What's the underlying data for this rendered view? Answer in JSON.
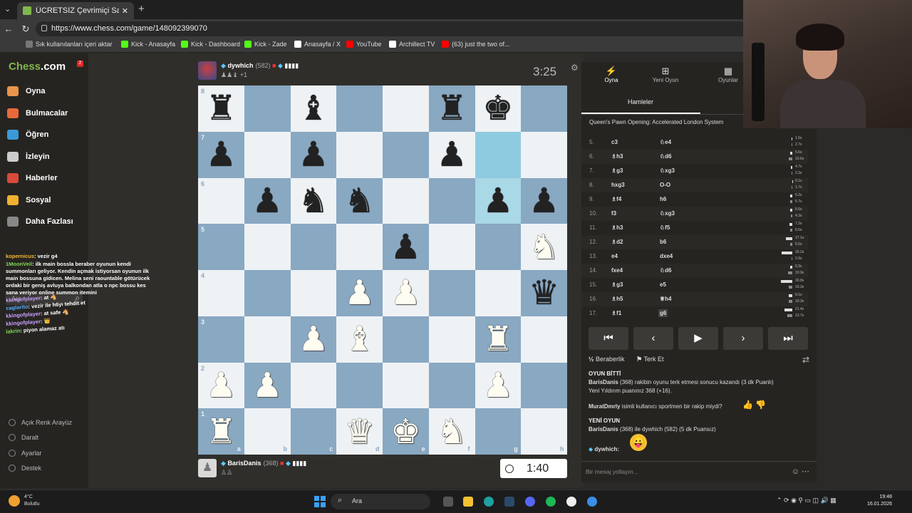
{
  "browser": {
    "tab_title": "ÜCRETSİZ Çevrimiçi Satranç Oyna...",
    "url": "https://www.chess.com/game/148092399070",
    "bookmarks": [
      "Sık kullanılanları içeri aktar",
      "Kick - Anasayfa",
      "Kick - Dashboard",
      "Kick - Zade",
      "Anasayfa / X",
      "YouTube",
      "Archillect TV",
      "(63) just the two of..."
    ],
    "bookmark_colors": [
      "#777777",
      "#53fc18",
      "#53fc18",
      "#53fc18",
      "#ffffff",
      "#ff0000",
      "#ffffff",
      "#ff0000"
    ]
  },
  "sidebar": {
    "logo_a": "Chess",
    "logo_b": ".com",
    "notification_count": "2",
    "items": [
      {
        "label": "Oyna",
        "color": "#e8954a"
      },
      {
        "label": "Bulmacalar",
        "color": "#e86a3a"
      },
      {
        "label": "Öğren",
        "color": "#3a9ad9"
      },
      {
        "label": "İzleyin",
        "color": "#cccccc"
      },
      {
        "label": "Haberler",
        "color": "#d94a3a"
      },
      {
        "label": "Sosyal",
        "color": "#f0b030"
      },
      {
        "label": "Daha Fazlası",
        "color": "#888888"
      }
    ],
    "search_placeholder": "Ara",
    "bottom": [
      "Açık Renk Arayüz",
      "Daralt",
      "Ayarlar",
      "Destek"
    ]
  },
  "chat_overlay": [
    {
      "user": "kopernicus",
      "msg": "vezir g4",
      "color": "#f3b83b"
    },
    {
      "user": "1MoonVeil",
      "msg": "ilk main bossla beraber oyunun kendi summonları geliyor. Kendin açmak istiyorsan oyunun ilk main bossuna gidicen. Melina seni raountable götürücek ordaki bir geniş avluya balkondan atla o npc bossu kes sana veriyor online summon itemini",
      "color": "#7ed957"
    },
    {
      "user": "kkingofplayer",
      "msg": "at 🐴",
      "color": "#c9a0ff"
    },
    {
      "user": "caglarito",
      "msg": "vezir ile h6yı tehdit et",
      "color": "#5ab0ff"
    },
    {
      "user": "kkingofplayer",
      "msg": "at safe 🐴",
      "color": "#c9a0ff"
    },
    {
      "user": "kkingofplayer",
      "msg": "👑",
      "color": "#c9a0ff"
    },
    {
      "user": "lakrin",
      "msg": "piyon alamaz atı",
      "color": "#7ed957"
    }
  ],
  "top_player": {
    "name": "dywhich",
    "rating": "(582)",
    "clock": "3:25",
    "captured": "+1"
  },
  "bottom_player": {
    "name": "BarisDanis",
    "rating": "(368)",
    "clock": "1:40"
  },
  "board": {
    "files": [
      "a",
      "b",
      "c",
      "d",
      "e",
      "f",
      "g",
      "h"
    ],
    "ranks": [
      "8",
      "7",
      "6",
      "5",
      "4",
      "3",
      "2",
      "1"
    ],
    "highlight": [
      "g7",
      "g6"
    ],
    "pieces": [
      {
        "sq": "a8",
        "p": "r"
      },
      {
        "sq": "c8",
        "p": "b"
      },
      {
        "sq": "f8",
        "p": "r"
      },
      {
        "sq": "g8",
        "p": "k"
      },
      {
        "sq": "a7",
        "p": "p"
      },
      {
        "sq": "c7",
        "p": "p"
      },
      {
        "sq": "f7",
        "p": "p"
      },
      {
        "sq": "b6",
        "p": "p"
      },
      {
        "sq": "c6",
        "p": "n"
      },
      {
        "sq": "d6",
        "p": "n"
      },
      {
        "sq": "g6",
        "p": "p"
      },
      {
        "sq": "h6",
        "p": "p"
      },
      {
        "sq": "e5",
        "p": "p"
      },
      {
        "sq": "h5",
        "p": "N"
      },
      {
        "sq": "d4",
        "p": "P"
      },
      {
        "sq": "e4",
        "p": "P"
      },
      {
        "sq": "h4",
        "p": "q"
      },
      {
        "sq": "c3",
        "p": "P"
      },
      {
        "sq": "d3",
        "p": "B"
      },
      {
        "sq": "g3",
        "p": "R"
      },
      {
        "sq": "a2",
        "p": "P"
      },
      {
        "sq": "b2",
        "p": "P"
      },
      {
        "sq": "g2",
        "p": "P"
      },
      {
        "sq": "a1",
        "p": "R"
      },
      {
        "sq": "d1",
        "p": "Q"
      },
      {
        "sq": "e1",
        "p": "K"
      },
      {
        "sq": "f1",
        "p": "N"
      }
    ]
  },
  "panel": {
    "tabs": [
      {
        "icon": "⚡",
        "label": "Oyna"
      },
      {
        "icon": "⊞",
        "label": "Yeni Oyun"
      },
      {
        "icon": "▦",
        "label": "Oyunlar"
      }
    ],
    "subtab": "Hamleler",
    "opening": "Queen's Pawn Opening: Accelerated London System",
    "moves": [
      {
        "n": "5.",
        "w": "c3",
        "b": "♘e4",
        "tw": "1.6s",
        "tb": "2.7s",
        "fw": 0.05,
        "fb": 0.08
      },
      {
        "n": "6.",
        "w": "♗h3",
        "b": "♘d6",
        "tw": "5.6s",
        "tb": "10.6s",
        "fw": 0.16,
        "fb": 0.3
      },
      {
        "n": "7.",
        "w": "♗g3",
        "b": "♘xg3",
        "tw": "4.7s",
        "tb": "2.3s",
        "fw": 0.13,
        "fb": 0.07
      },
      {
        "n": "8.",
        "w": "hxg3",
        "b": "O-O",
        "tw": "0.1s",
        "tb": "1.7s",
        "fw": 0.01,
        "fb": 0.05
      },
      {
        "n": "9.",
        "w": "♗f4",
        "b": "h6",
        "tw": "5.2s",
        "tb": "5.7s",
        "fw": 0.15,
        "fb": 0.16
      },
      {
        "n": "10.",
        "w": "f3",
        "b": "♘xg3",
        "tw": "6.6s",
        "tb": "4.3s",
        "fw": 0.19,
        "fb": 0.12
      },
      {
        "n": "11.",
        "w": "♗h3",
        "b": "♘f5",
        "tw": "7.2s",
        "tb": "6.0s",
        "fw": 0.2,
        "fb": 0.17
      },
      {
        "n": "12.",
        "w": "♗d2",
        "b": "b6",
        "tw": "17.1s",
        "tb": "5.6s",
        "fw": 0.49,
        "fb": 0.16
      },
      {
        "n": "13.",
        "w": "e4",
        "b": "dxe4",
        "tw": "30.2s",
        "tb": "2.9s",
        "fw": 0.86,
        "fb": 0.08
      },
      {
        "n": "14.",
        "w": "fxe4",
        "b": "♘d6",
        "tw": "6.3s",
        "tb": "10.9s",
        "fw": 0.18,
        "fb": 0.31
      },
      {
        "n": "15.",
        "w": "♗g3",
        "b": "e5",
        "tw": "30.8s",
        "tb": "10.3s",
        "fw": 0.88,
        "fb": 0.29
      },
      {
        "n": "16.",
        "w": "♗h5",
        "b": "♕h4",
        "tw": "9.1s",
        "tb": "10.3s",
        "fw": 0.26,
        "fb": 0.29
      },
      {
        "n": "17.",
        "w": "♗f1",
        "b": "g6",
        "tw": "21.4s",
        "tb": "13.7s",
        "fw": 0.61,
        "fb": 0.39
      }
    ],
    "controls": [
      "⏮",
      "◀",
      "▶",
      "▶",
      "⏭"
    ],
    "draw_label": "Beraberlik",
    "resign_label": "Terk Et",
    "log": {
      "game_over": "OYUN BİTTİ",
      "result_user": "BarisDanis",
      "result_text": "(368) rakibin oyunu terk etmesi sonucu kazandı (3 dk Puanlı)",
      "rating_line": "Yeni Yıldırım puanınız 368 (+16).",
      "survey_user": "MuratDmrly",
      "survey_text": "isimli kullanıcı sportmen bir rakip miydi?",
      "new_game": "YENİ OYUN",
      "new_user": "BarisDanis",
      "new_text": "(368) ile dywhich (582) (5 dk Puansız)",
      "chat_user": "dywhich:"
    },
    "message_placeholder": "Bir mesaj yollayın..."
  },
  "taskbar": {
    "temp": "4°C",
    "weather": "Bulutlu",
    "search": "Ara",
    "time": "19:48",
    "date": "16.01.2026"
  }
}
